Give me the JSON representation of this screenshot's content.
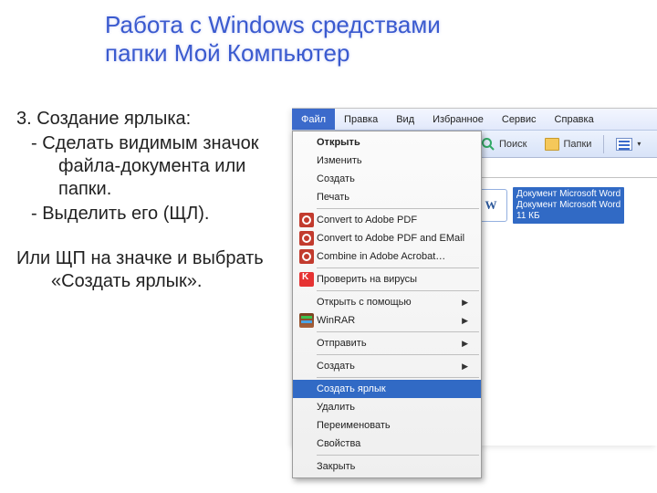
{
  "title_line1": "Работа с Windows средствами",
  "title_line2": "папки Мой Компьютер",
  "text": {
    "heading": "3. Создание ярлыка:",
    "b1": " - Сделать видимым значок файла-документа или папки.",
    "b2": " - Выделить его (ЩЛ).",
    "alt": "Или ЩП на значке и выбрать «Создать ярлык»."
  },
  "menubar": [
    "Файл",
    "Правка",
    "Вид",
    "Избранное",
    "Сервис",
    "Справка"
  ],
  "toolbar": {
    "search": "Поиск",
    "folders": "Папки"
  },
  "dropdown": {
    "open": "Открыть",
    "edit": "Изменить",
    "new": "Создать",
    "print": "Печать",
    "pdf1": "Convert to Adobe PDF",
    "pdf2": "Convert to Adobe PDF and EMail",
    "pdf3": "Combine in Adobe Acrobat…",
    "virus": "Проверить на вирусы",
    "openwith": "Открыть с помощью",
    "winrar": "WinRAR",
    "sendto": "Отправить",
    "create": "Создать",
    "shortcut": "Создать ярлык",
    "delete": "Удалить",
    "rename": "Переименовать",
    "properties": "Свойства",
    "close": "Закрыть"
  },
  "file": {
    "letter": "W",
    "name1": "Документ Microsoft Word",
    "name2": "Документ Microsoft Word",
    "size": "11 КБ"
  }
}
